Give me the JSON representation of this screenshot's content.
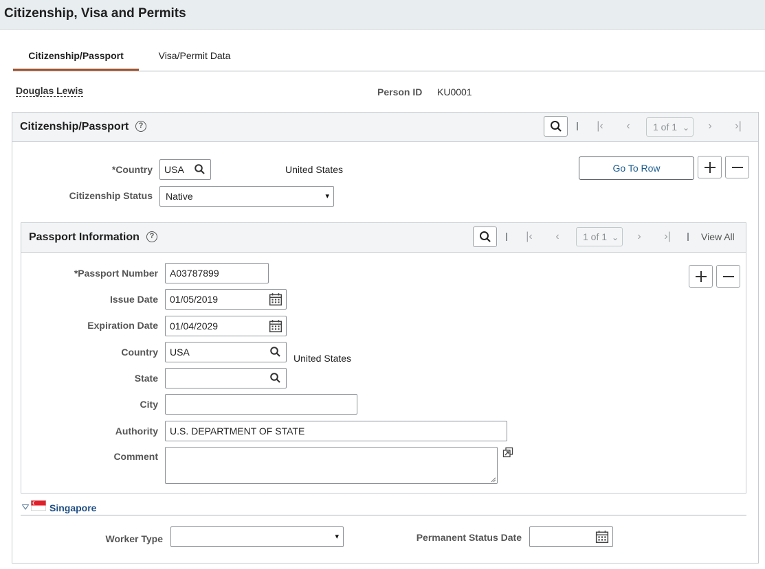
{
  "page": {
    "title": "Citizenship, Visa and Permits"
  },
  "tabs": [
    {
      "label": "Citizenship/Passport",
      "active": true
    },
    {
      "label": "Visa/Permit Data",
      "active": false
    }
  ],
  "person": {
    "name": "Douglas Lewis",
    "id_label": "Person ID",
    "id_value": "KU0001"
  },
  "citizenship": {
    "title": "Citizenship/Passport",
    "pager": "1 of 1",
    "country_label": "*Country",
    "country_value": "USA",
    "country_desc": "United States",
    "status_label": "Citizenship Status",
    "status_value": "Native",
    "goto_label": "Go To Row"
  },
  "passport": {
    "title": "Passport Information",
    "pager": "1 of 1",
    "view_all": "View All",
    "number_label": "*Passport Number",
    "number_value": "A03787899",
    "issue_label": "Issue Date",
    "issue_value": "01/05/2019",
    "expiration_label": "Expiration Date",
    "expiration_value": "01/04/2029",
    "country_label": "Country",
    "country_value": "USA",
    "country_desc": "United States",
    "state_label": "State",
    "state_value": "",
    "city_label": "City",
    "city_value": "",
    "authority_label": "Authority",
    "authority_value": "U.S. DEPARTMENT OF STATE",
    "comment_label": "Comment",
    "comment_value": ""
  },
  "singapore": {
    "title": "Singapore",
    "worker_type_label": "Worker Type",
    "worker_type_value": "",
    "perm_status_label": "Permanent Status Date",
    "perm_status_value": ""
  },
  "colors": {
    "accent_tab": "#a0522d",
    "link": "#1b5c8f",
    "header_bg": "#e8eef0"
  }
}
